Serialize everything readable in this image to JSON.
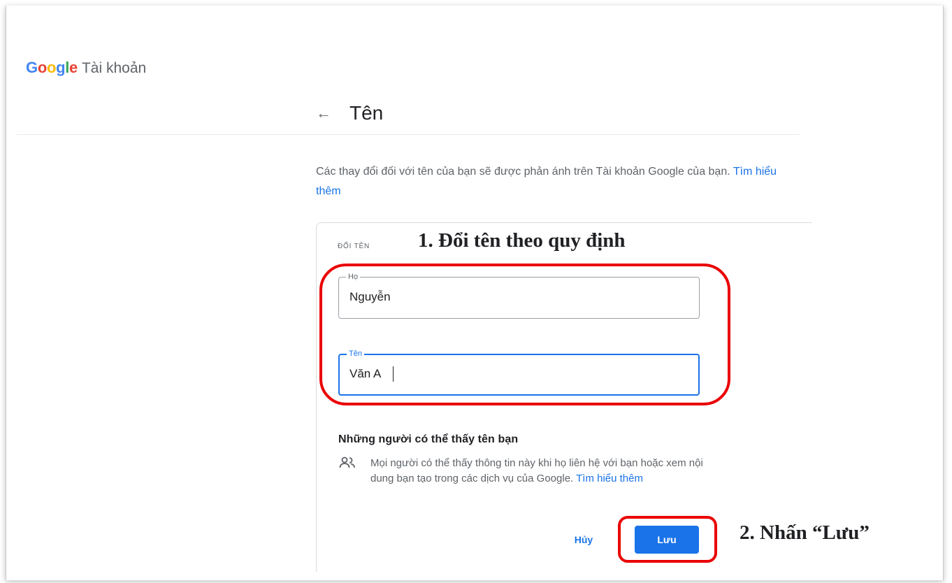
{
  "brand": {
    "letters": [
      {
        "char": "G",
        "color": "#4285f4"
      },
      {
        "char": "o",
        "color": "#ea4335"
      },
      {
        "char": "o",
        "color": "#fbbc05"
      },
      {
        "char": "g",
        "color": "#4285f4"
      },
      {
        "char": "l",
        "color": "#34a853"
      },
      {
        "char": "e",
        "color": "#ea4335"
      }
    ],
    "product": "Tài khoản"
  },
  "header": {
    "back_icon": "arrow-left-icon",
    "title": "Tên"
  },
  "intro": {
    "text": "Các thay đổi đối với tên của bạn sẽ được phản ánh trên Tài khoản Google của bạn.",
    "link": "Tìm hiểu thêm"
  },
  "form": {
    "section_label": "ĐỔI TÊN",
    "last_name": {
      "label": "Họ",
      "value": "Nguyễn"
    },
    "first_name": {
      "label": "Tên",
      "value": "Văn A"
    }
  },
  "visibility": {
    "title": "Những người có thể thấy tên bạn",
    "icon": "people-icon",
    "text": "Mọi người có thể thấy thông tin này khi họ liên hệ với bạn hoặc xem nội dung bạn tạo trong các dịch vụ của Google.",
    "link": "Tìm hiểu thêm"
  },
  "actions": {
    "cancel": "Hủy",
    "save": "Lưu"
  },
  "annotations": {
    "step1": "1. Đổi tên theo quy định",
    "step2": "2. Nhấn “Lưu”",
    "highlight_color": "#ea0000"
  },
  "colors": {
    "accent": "#1a73e8",
    "text_secondary": "#5f6368"
  }
}
